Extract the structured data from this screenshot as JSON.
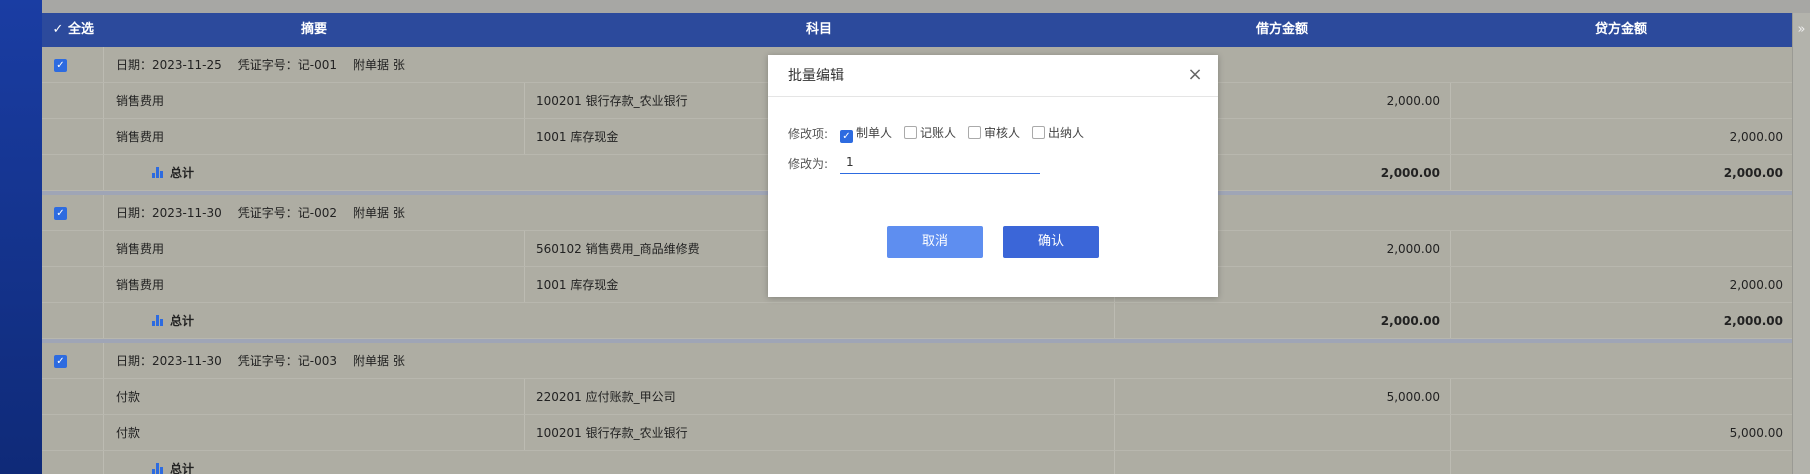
{
  "header": {
    "select_all": "全选",
    "col_abstract": "摘要",
    "col_account": "科目",
    "col_debit": "借方金额",
    "col_credit": "贷方金额"
  },
  "scroll_arrow": "»",
  "groups": [
    {
      "meta": {
        "date": "日期：2023-11-25",
        "voucher": "凭证字号：记-001",
        "attach": "附单据  张"
      },
      "rows": [
        {
          "abstract": "销售费用",
          "account": "100201  银行存款_农业银行",
          "debit": "2,000.00",
          "credit": ""
        },
        {
          "abstract": "销售费用",
          "account": "1001  库存现金",
          "debit": "",
          "credit": "2,000.00"
        }
      ],
      "total": {
        "label": "总计",
        "debit": "2,000.00",
        "credit": "2,000.00"
      }
    },
    {
      "meta": {
        "date": "日期：2023-11-30",
        "voucher": "凭证字号：记-002",
        "attach": "附单据  张"
      },
      "rows": [
        {
          "abstract": "销售费用",
          "account": "560102  销售费用_商品维修费",
          "debit": "2,000.00",
          "credit": ""
        },
        {
          "abstract": "销售费用",
          "account": "1001  库存现金",
          "debit": "",
          "credit": "2,000.00"
        }
      ],
      "total": {
        "label": "总计",
        "debit": "2,000.00",
        "credit": "2,000.00"
      }
    },
    {
      "meta": {
        "date": "日期：2023-11-30",
        "voucher": "凭证字号：记-003",
        "attach": "附单据  张"
      },
      "rows": [
        {
          "abstract": "付款",
          "account": "220201  应付账款_甲公司",
          "debit": "5,000.00",
          "credit": ""
        },
        {
          "abstract": "付款",
          "account": "100201  银行存款_农业银行",
          "debit": "",
          "credit": "5,000.00"
        }
      ],
      "total": {
        "label": "总计",
        "debit": "",
        "credit": ""
      }
    }
  ],
  "modal": {
    "title": "批量编辑",
    "close": "×",
    "field_label": "修改项:",
    "options": [
      {
        "label": "制单人",
        "checked": true
      },
      {
        "label": "记账人",
        "checked": false
      },
      {
        "label": "审核人",
        "checked": false
      },
      {
        "label": "出纳人",
        "checked": false
      }
    ],
    "value_label": "修改为:",
    "value": "1",
    "cancel": "取消",
    "confirm": "确认"
  },
  "colors": {
    "header_bg": "#2c4a9c",
    "checkbox": "#2d6be0",
    "cancel_button": "#5e8ef0",
    "confirm_button": "#3b66d8"
  }
}
